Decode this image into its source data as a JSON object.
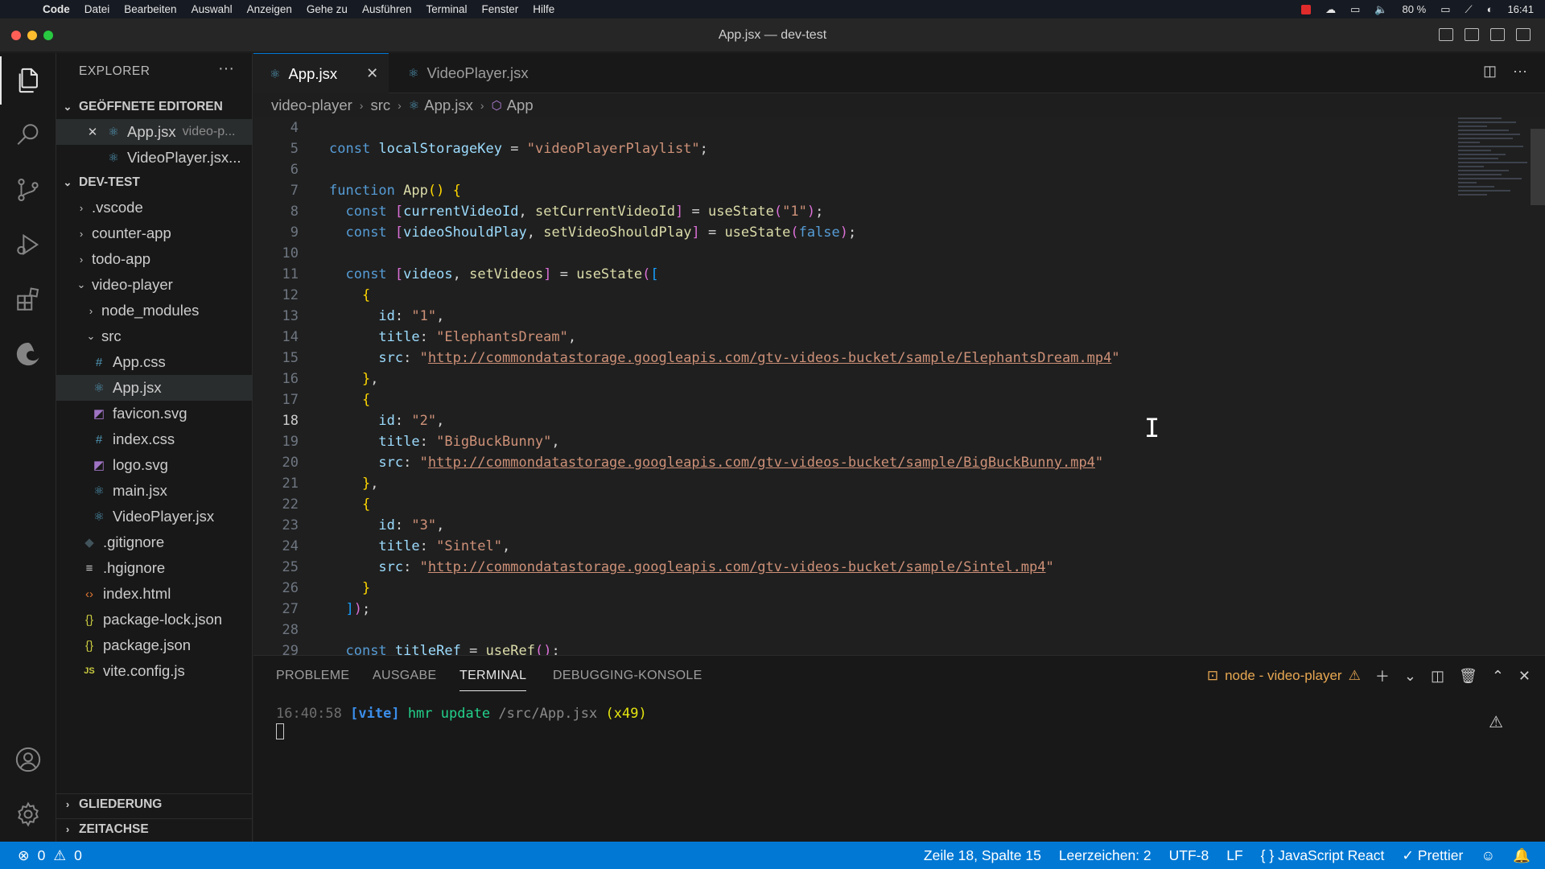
{
  "menubar": {
    "app": "Code",
    "items": [
      "Datei",
      "Bearbeiten",
      "Auswahl",
      "Anzeigen",
      "Gehe zu",
      "Ausführen",
      "Terminal",
      "Fenster",
      "Hilfe"
    ],
    "battery": "80 %",
    "clock": "16:41"
  },
  "window": {
    "title": "App.jsx — dev-test"
  },
  "sidebar": {
    "title": "EXPLORER",
    "open_editors": {
      "label": "GEÖFFNETE EDITOREN",
      "items": [
        {
          "name": "App.jsx",
          "desc": "video-p..."
        },
        {
          "name": "VideoPlayer.jsx..."
        }
      ]
    },
    "project": {
      "label": "DEV-TEST",
      "items": [
        ".vscode",
        "counter-app",
        "todo-app",
        "video-player",
        "node_modules",
        "src",
        "App.css",
        "App.jsx",
        "favicon.svg",
        "index.css",
        "logo.svg",
        "main.jsx",
        "VideoPlayer.jsx",
        ".gitignore",
        ".hgignore",
        "index.html",
        "package-lock.json",
        "package.json",
        "vite.config.js"
      ]
    },
    "outline": "GLIEDERUNG",
    "timeline": "ZEITACHSE"
  },
  "tabs": [
    {
      "label": "App.jsx",
      "active": true
    },
    {
      "label": "VideoPlayer.jsx",
      "active": false
    }
  ],
  "breadcrumb": [
    "video-player",
    "src",
    "App.jsx",
    "App"
  ],
  "editor": {
    "current_line": 18,
    "line_numbers": [
      "4",
      "5",
      "6",
      "7",
      "8",
      "9",
      "10",
      "11",
      "12",
      "13",
      "14",
      "15",
      "16",
      "17",
      "18",
      "19",
      "20",
      "21",
      "22",
      "23",
      "24",
      "25",
      "26",
      "27",
      "28",
      "29"
    ],
    "strings": {
      "storage_key": "\"videoPlayerPlaylist\"",
      "id1": "\"1\"",
      "title1": "\"ElephantsDream\"",
      "url1": "http://commondatastorage.googleapis.com/gtv-videos-bucket/sample/ElephantsDream.mp4",
      "id2": "\"2\"",
      "title2": "\"BigBuckBunny\"",
      "url2": "http://commondatastorage.googleapis.com/gtv-videos-bucket/sample/BigBuckBunny.mp4",
      "id3": "\"3\"",
      "title3": "\"Sintel\"",
      "url3": "http://commondatastorage.googleapis.com/gtv-videos-bucket/sample/Sintel.mp4",
      "state1": "\"1\""
    }
  },
  "panel": {
    "tabs": [
      "PROBLEME",
      "AUSGABE",
      "TERMINAL",
      "DEBUGGING-KONSOLE"
    ],
    "active_tab": "TERMINAL",
    "terminal_name": "node - video-player",
    "output": {
      "time": "16:40:58",
      "tag": "[vite]",
      "msg": "hmr update",
      "path": "/src/App.jsx",
      "count": "(x49)"
    }
  },
  "statusbar": {
    "errors": "0",
    "warnings": "0",
    "position": "Zeile 18, Spalte 15",
    "indent": "Leerzeichen: 2",
    "encoding": "UTF-8",
    "eol": "LF",
    "language": "JavaScript React",
    "formatter": "Prettier"
  }
}
